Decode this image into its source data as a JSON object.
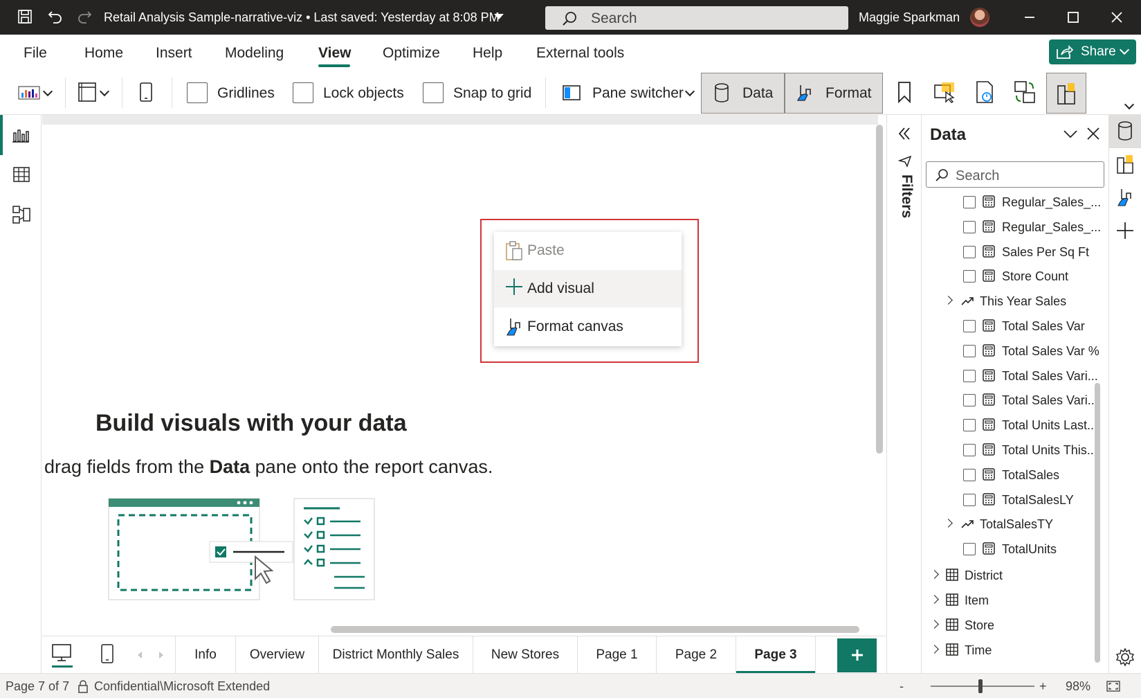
{
  "titlebar": {
    "title": "Retail Analysis Sample-narrative-viz • Last saved: Yesterday at 8:08 PM",
    "search_placeholder": "Search",
    "user_name": "Maggie Sparkman"
  },
  "menu": {
    "items": [
      "File",
      "Home",
      "Insert",
      "Modeling",
      "View",
      "Optimize",
      "Help",
      "External tools"
    ],
    "active": "View",
    "share_label": "Share"
  },
  "ribbon": {
    "gridlines_label": "Gridlines",
    "lock_objects_label": "Lock objects",
    "snap_to_grid_label": "Snap to grid",
    "pane_switcher_label": "Pane switcher",
    "data_label": "Data",
    "format_label": "Format"
  },
  "context_menu": {
    "paste_label": "Paste",
    "add_visual_label": "Add visual",
    "format_canvas_label": "Format canvas"
  },
  "canvas": {
    "heading": "Build visuals with your data",
    "sub_prefix": "drag fields from the ",
    "sub_bold": "Data",
    "sub_suffix": " pane onto the report canvas."
  },
  "page_tabs": {
    "tabs": [
      "Info",
      "Overview",
      "District Monthly Sales",
      "New Stores",
      "Page 1",
      "Page 2",
      "Page 3"
    ],
    "active": "Page 3",
    "add_label": "+"
  },
  "filters": {
    "label": "Filters"
  },
  "data_pane": {
    "title": "Data",
    "search_placeholder": "Search",
    "fields": [
      "Regular_Sales_...",
      "Regular_Sales_...",
      "Sales Per Sq Ft",
      "Store Count",
      "This Year Sales",
      "Total Sales Var",
      "Total Sales Var %",
      "Total Sales Vari...",
      "Total Sales Vari...",
      "Total Units Last...",
      "Total Units This...",
      "TotalSales",
      "TotalSalesLY",
      "TotalSalesTY",
      "TotalUnits"
    ],
    "tables": [
      "District",
      "Item",
      "Store",
      "Time"
    ]
  },
  "status": {
    "page_info": "Page 7 of 7",
    "sensitivity": "Confidential\\Microsoft Extended",
    "zoom_minus": "-",
    "zoom_plus": "+",
    "zoom": "98%"
  },
  "colors": {
    "accent": "#117865",
    "titlebar": "#252423",
    "highlight_outline": "#d13438"
  }
}
